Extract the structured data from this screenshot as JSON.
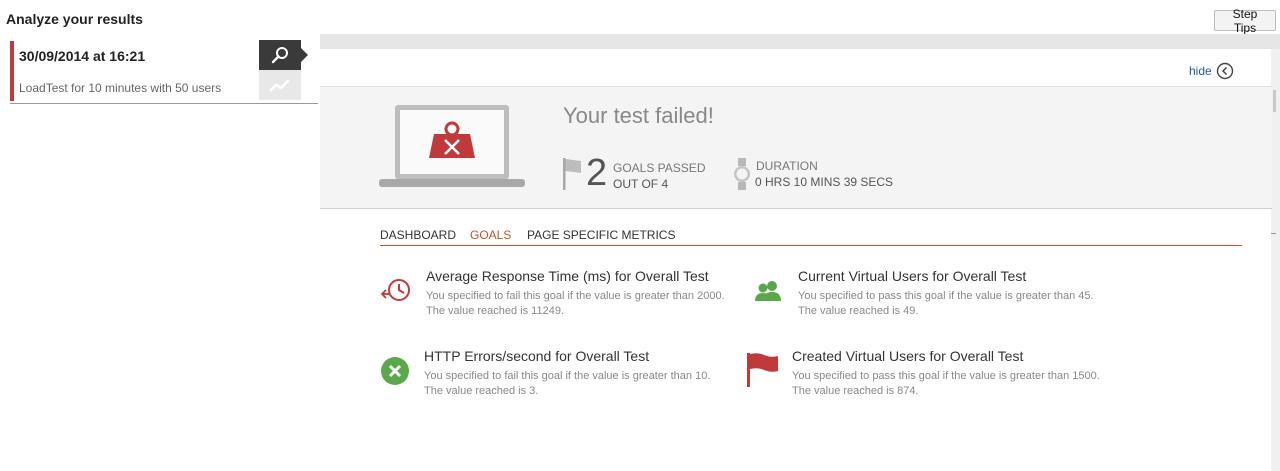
{
  "page": {
    "title": "Analyze your results",
    "step_tips": "Step Tips"
  },
  "run": {
    "date": "30/09/2014 at 16:21",
    "description": "LoadTest for 10 minutes with 50 users"
  },
  "toolbar": {
    "search_icon": "search-icon",
    "trend_icon": "trend-icon"
  },
  "hide_link": "hide",
  "summary": {
    "title": "Your test failed!",
    "goals_passed": "2",
    "goals_passed_label": "GOALS PASSED",
    "goals_total": "OUT OF 4",
    "duration_label": "DURATION",
    "duration_value": "0 HRS  10 MINS  39 SECS"
  },
  "tabs": [
    {
      "label": "DASHBOARD",
      "active": false
    },
    {
      "label": "GOALS",
      "active": true
    },
    {
      "label": "PAGE SPECIFIC METRICS",
      "active": false
    }
  ],
  "goals": [
    {
      "title": "Average Response Time (ms) for Overall Test",
      "description": "You specified to fail this goal if the value is greater than 2000. The value reached is 11249.",
      "icon": "response-time-clock-icon",
      "status": "failed"
    },
    {
      "title": "Current Virtual Users for Overall Test",
      "description": "You specified to pass this goal if the value is greater than 45. The value reached is 49.",
      "icon": "users-icon",
      "status": "passed"
    },
    {
      "title": "HTTP Errors/second for Overall Test",
      "description": "You specified to fail this goal if the value is greater than 10. The value reached is 3.",
      "icon": "error-x-icon",
      "status": "passed"
    },
    {
      "title": "Created Virtual Users for Overall Test",
      "description": "You specified to pass this goal if the value is greater than 1500. The value reached is 874.",
      "icon": "red-flag-icon",
      "status": "failed"
    }
  ],
  "colors": {
    "accent": "#c5542b",
    "fail": "#c0393b",
    "pass": "#5aa74c",
    "link": "#1f5b99"
  }
}
